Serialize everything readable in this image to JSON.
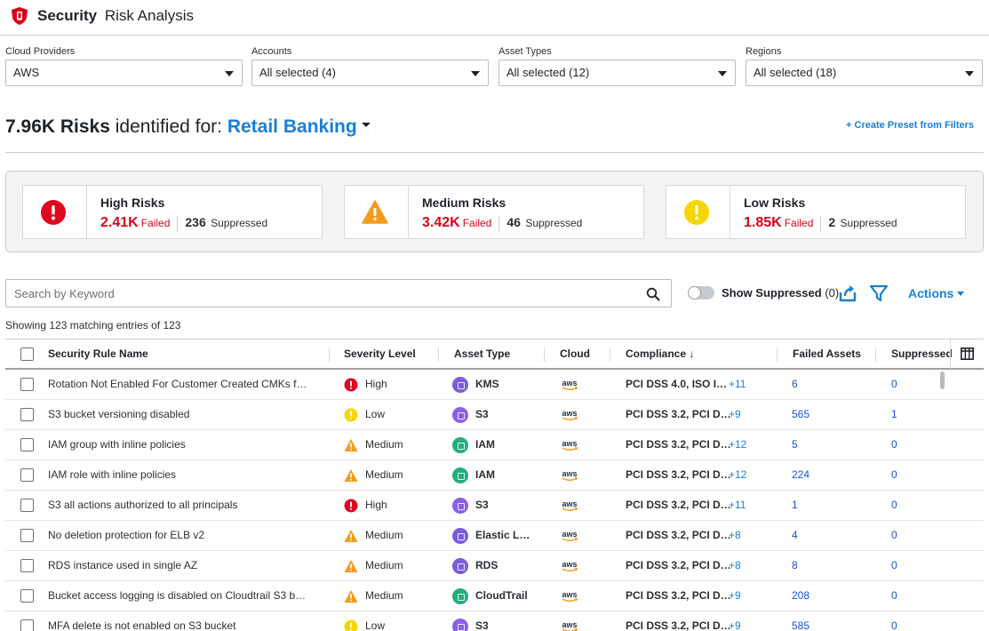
{
  "header": {
    "title_bold": "Security",
    "title_rest": "Risk Analysis",
    "brand_color": "#d6051a"
  },
  "filters": [
    {
      "label": "Cloud Providers",
      "value": "AWS"
    },
    {
      "label": "Accounts",
      "value": "All selected (4)"
    },
    {
      "label": "Asset Types",
      "value": "All selected (12)"
    },
    {
      "label": "Regions",
      "value": "All selected (18)"
    }
  ],
  "risks": {
    "count": "7.96K Risks",
    "middle": " identified for: ",
    "tenant": "Retail Banking",
    "create_preset": "+ Create Preset from Filters"
  },
  "summary": [
    {
      "title": "High Risks",
      "failed": "2.41K",
      "failed_label": "Failed",
      "suppressed": "236",
      "suppressed_label": "Suppressed",
      "icon": "error-circle-icon",
      "color": "#e0061f"
    },
    {
      "title": "Medium Risks",
      "failed": "3.42K",
      "failed_label": "Failed",
      "suppressed": "46",
      "suppressed_label": "Suppressed",
      "icon": "warning-triangle-icon",
      "color": "#f59a1b"
    },
    {
      "title": "Low Risks",
      "failed": "1.85K",
      "failed_label": "Failed",
      "suppressed": "2",
      "suppressed_label": "Suppressed",
      "icon": "info-circle-icon",
      "color": "#f6d600"
    }
  ],
  "toolbar": {
    "search_placeholder": "Search by Keyword",
    "show_suppressed": "Show Suppressed",
    "suppressed_count": "(0)",
    "actions": "Actions"
  },
  "showing": "Showing 123 matching entries of 123",
  "table": {
    "headers": {
      "rule": "Security Rule Name",
      "severity": "Severity Level",
      "asset": "Asset Type",
      "cloud": "Cloud",
      "compliance": "Compliance ↓",
      "failed": "Failed Assets",
      "suppressed": "Suppressed"
    },
    "rows": [
      {
        "rule": "Rotation Not Enabled For Customer Created CMKs f…",
        "severity": "High",
        "asset": "KMS",
        "compliance": "PCI DSS 4.0, ISO I…",
        "more": "+11",
        "failed": "6",
        "suppressed": "0"
      },
      {
        "rule": "S3 bucket versioning disabled",
        "severity": "Low",
        "asset": "S3",
        "compliance": "PCI DSS 3.2, PCI D…",
        "more": "+9",
        "failed": "565",
        "suppressed": "1"
      },
      {
        "rule": "IAM group with inline policies",
        "severity": "Medium",
        "asset": "IAM",
        "compliance": "PCI DSS 3.2, PCI D…",
        "more": "+12",
        "failed": "5",
        "suppressed": "0"
      },
      {
        "rule": "IAM role with inline policies",
        "severity": "Medium",
        "asset": "IAM",
        "compliance": "PCI DSS 3.2, PCI D…",
        "more": "+12",
        "failed": "224",
        "suppressed": "0"
      },
      {
        "rule": "S3 all actions authorized to all principals",
        "severity": "High",
        "asset": "S3",
        "compliance": "PCI DSS 3.2, PCI D…",
        "more": "+11",
        "failed": "1",
        "suppressed": "0"
      },
      {
        "rule": "No deletion protection for ELB v2",
        "severity": "Medium",
        "asset": "Elastic L…",
        "compliance": "PCI DSS 3.2, PCI D…",
        "more": "+8",
        "failed": "4",
        "suppressed": "0"
      },
      {
        "rule": "RDS instance used in single AZ",
        "severity": "Medium",
        "asset": "RDS",
        "compliance": "PCI DSS 3.2, PCI D…",
        "more": "+8",
        "failed": "8",
        "suppressed": "0"
      },
      {
        "rule": "Bucket access logging is disabled on Cloudtrail S3 b…",
        "severity": "Medium",
        "asset": "CloudTrail",
        "compliance": "PCI DSS 3.2, PCI D…",
        "more": "+9",
        "failed": "208",
        "suppressed": "0"
      },
      {
        "rule": "MFA delete is not enabled on S3 bucket",
        "severity": "Low",
        "asset": "S3",
        "compliance": "PCI DSS 3.2, PCI D…",
        "more": "+9",
        "failed": "585",
        "suppressed": "0"
      }
    ]
  },
  "asset_colors": {
    "KMS": "#7b5ce0",
    "S3": "#8a5fe8",
    "IAM": "#22b07a",
    "Elastic L…": "#7b5ce0",
    "RDS": "#7b5ce0",
    "CloudTrail": "#22b07a"
  },
  "cloud_label": "aws"
}
